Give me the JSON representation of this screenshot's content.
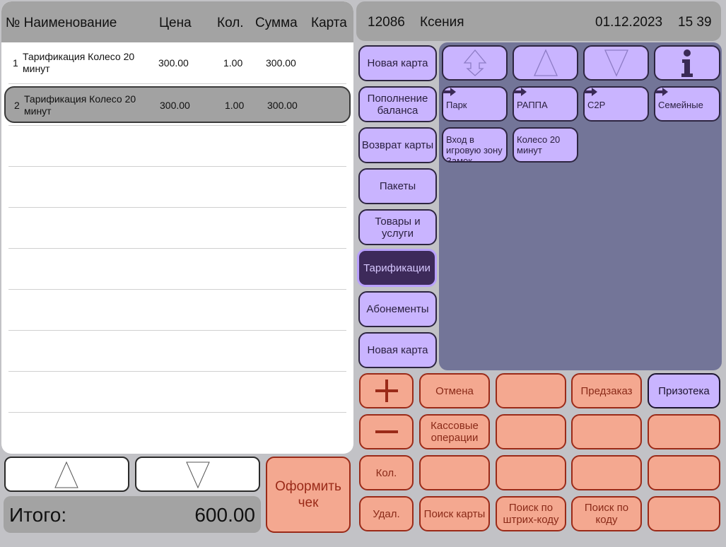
{
  "receipt": {
    "columns": {
      "number_name": "№ Наименование",
      "price": "Цена",
      "qty": "Кол.",
      "sum": "Сумма",
      "card": "Карта"
    },
    "items": [
      {
        "num": "1",
        "name": "Тарификация Колесо 20 минут",
        "price": "300.00",
        "qty": "1.00",
        "sum": "300.00",
        "card": ""
      },
      {
        "num": "2",
        "name": "Тарификация Колесо 20 минут",
        "price": "300.00",
        "qty": "1.00",
        "sum": "300.00",
        "card": ""
      }
    ],
    "selected_index": 1,
    "total_label": "Итого:",
    "total_value": "600.00"
  },
  "header": {
    "register_id": "12086",
    "cashier": "Ксения",
    "date": "01.12.2023",
    "time": "15 39"
  },
  "categories": [
    {
      "label": "Новая карта",
      "active": false
    },
    {
      "label": "Пополнение баланса",
      "active": false
    },
    {
      "label": "Возврат карты",
      "active": false
    },
    {
      "label": "Пакеты",
      "active": false
    },
    {
      "label": "Товары и услуги",
      "active": false
    },
    {
      "label": "Тарификации",
      "active": true
    },
    {
      "label": "Абонементы",
      "active": false
    },
    {
      "label": "Новая карта",
      "active": false
    }
  ],
  "nav_icons": [
    "back-to-top-icon",
    "arrow-up-icon",
    "arrow-down-icon",
    "info-icon"
  ],
  "tariff_folders": [
    {
      "label": "Парк"
    },
    {
      "label": "РАППА"
    },
    {
      "label": "C2P"
    },
    {
      "label": "Семейные"
    }
  ],
  "tariff_items": [
    {
      "label": "Вход в игровую зону Замок"
    },
    {
      "label": "Колесо 20 минут"
    }
  ],
  "actions": {
    "cancel": "Отмена",
    "preorder": "Предзаказ",
    "prize_store": "Призотека",
    "cash_operations": "Кассовые операции",
    "quantity": "Кол.",
    "delete": "Удал.",
    "search_card": "Поиск карты",
    "search_barcode": "Поиск по штрих-коду",
    "search_code": "Поиск по коду",
    "checkout": "Оформить чек"
  },
  "colors": {
    "background": "#c2c2c6",
    "header_gray": "#a3a3a3",
    "purple_button": "#c9b4ff",
    "purple_active": "#3d2a5a",
    "tariff_area": "#737598",
    "salmon_button": "#f4a890",
    "salmon_border": "#9a2a18"
  }
}
